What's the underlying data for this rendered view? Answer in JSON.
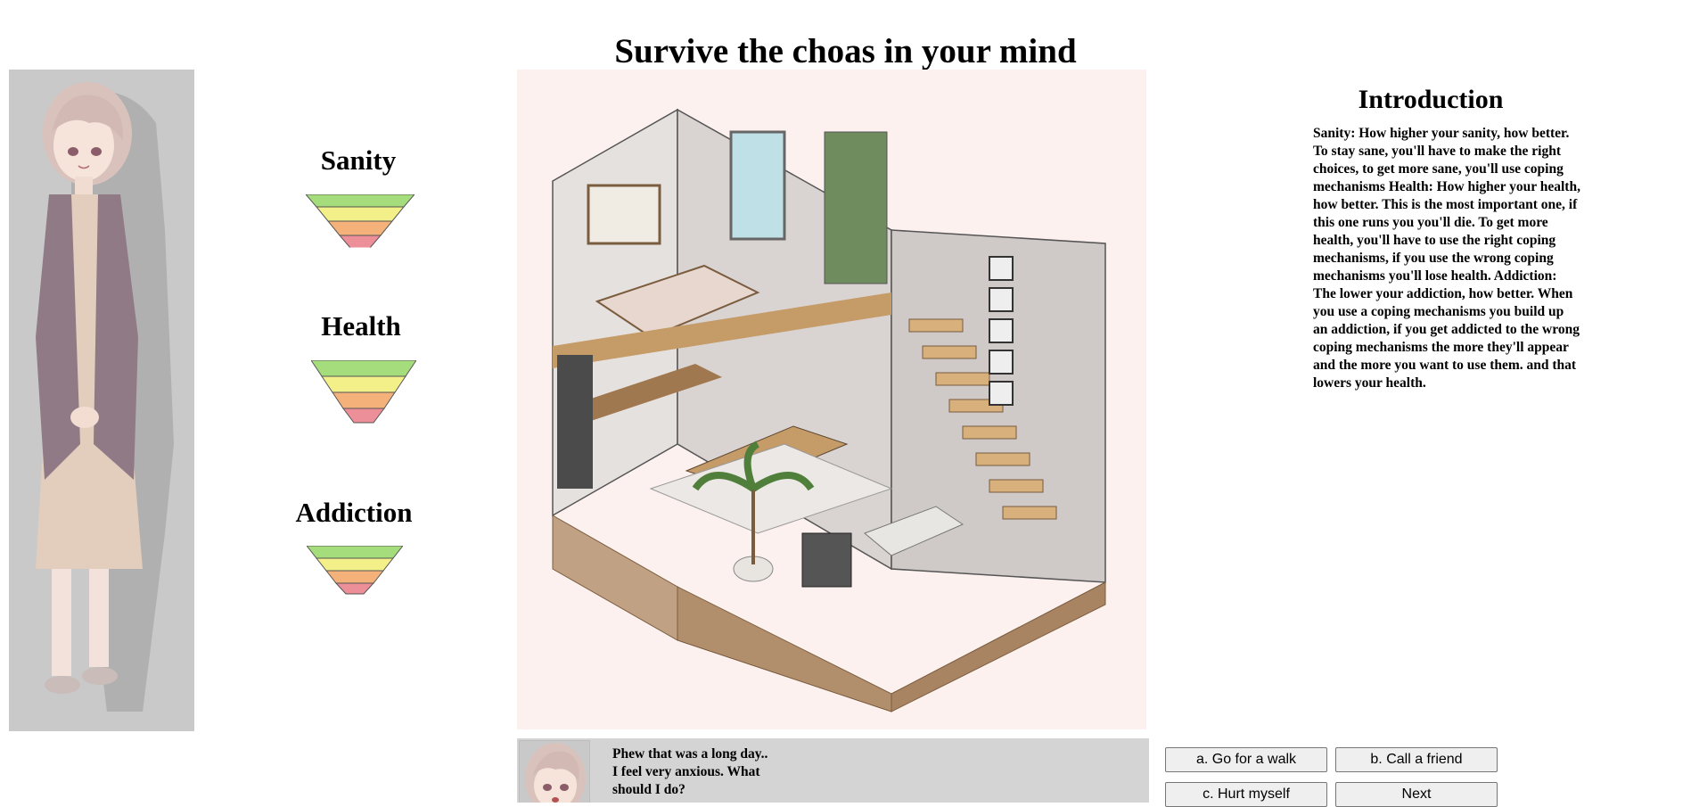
{
  "header": {
    "title": "Survive the choas in your mind"
  },
  "stats": {
    "sanity": {
      "label": "Sanity"
    },
    "health": {
      "label": "Health"
    },
    "addiction": {
      "label": "Addiction"
    }
  },
  "introduction": {
    "heading": "Introduction",
    "text": "Sanity: How higher your sanity, how better. To stay sane, you'll have to make the right choices, to get more sane, you'll use coping mechanisms Health: How higher your health, how better. This is the most important one, if this one runs you you'll die. To get more health, you'll have to use the right coping mechanisms, if you use the wrong coping mechanisms you'll lose health. Addiction: The lower your addiction, how better. When you use a coping mechanisms you build up an addiction, if you get addicted to the wrong coping mechanisms the more they'll appear and the more you want to use them. and that lowers your health."
  },
  "dialog": {
    "text": "Phew that was a long day..\nI feel very anxious. What\nshould I do?"
  },
  "choices": {
    "a": "a. Go for a walk",
    "b": "b. Call a friend",
    "c": "c. Hurt myself",
    "next": "Next"
  },
  "colors": {
    "meter_green": "#a6dd7c",
    "meter_yellow": "#f3f08a",
    "meter_orange": "#f4b27a",
    "meter_pink": "#ec8f98",
    "portrait_bg": "#c9c9c9",
    "scene_bg": "#fdf1ef",
    "dialog_bg": "#d4d4d4"
  }
}
